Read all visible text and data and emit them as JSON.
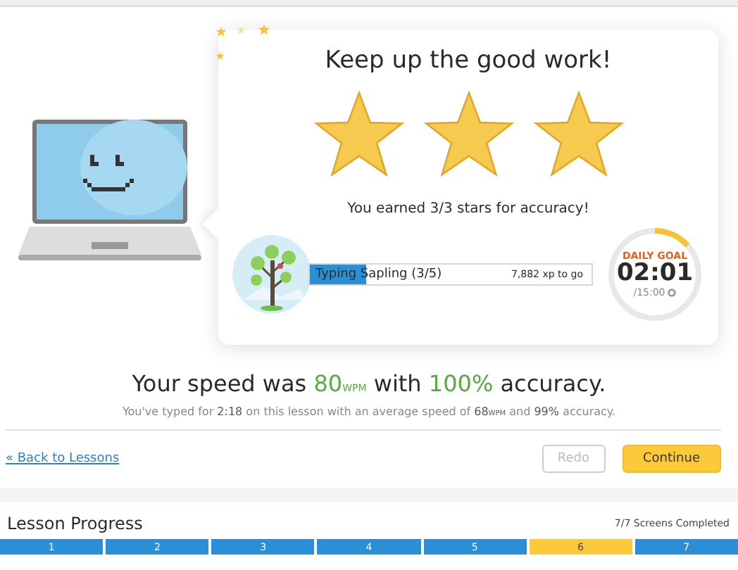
{
  "card": {
    "title": "Keep up the good work!",
    "stars": 3,
    "earned": "You earned 3/3 stars for accuracy!"
  },
  "level_bar": {
    "label": "Typing Sapling (3/5)",
    "level": 0.2,
    "xp": "7,882 xp to go"
  },
  "daily_goal": {
    "label": "DAILY GOAL",
    "time": "02:01",
    "total": "/15:00",
    "level": 0.134
  },
  "speed": [
    {
      "kind": "plain",
      "text": "Your speed was "
    },
    {
      "kind": "highlight",
      "text": "80"
    },
    {
      "kind": "unit",
      "text": "WPM"
    },
    {
      "kind": "plain",
      "text": " with "
    },
    {
      "kind": "highlight",
      "text": "100%"
    },
    {
      "kind": "plain",
      "text": " accuracy."
    }
  ],
  "summary": [
    {
      "kind": "plain",
      "text": "You've typed for "
    },
    {
      "kind": "highlight",
      "text": "2:18"
    },
    {
      "kind": "plain",
      "text": " on this lesson with an average speed of "
    },
    {
      "kind": "highlight",
      "text": "68"
    },
    {
      "kind": "unit",
      "text": "WPM"
    },
    {
      "kind": "plain",
      "text": " and "
    },
    {
      "kind": "highlight",
      "text": "99%"
    },
    {
      "kind": "plain",
      "text": " accuracy."
    }
  ],
  "back_link": "« Back to Lessons",
  "buttons": [
    {
      "label": "Redo",
      "disabled": true
    },
    {
      "label": "Continue",
      "disabled": false
    }
  ],
  "lesson_progress": {
    "title": "Lesson Progress",
    "completed": "7/7 Screens Completed",
    "screens": [
      {
        "label": "1",
        "selected": false
      },
      {
        "label": "2",
        "selected": false
      },
      {
        "label": "3",
        "selected": false
      },
      {
        "label": "4",
        "selected": false
      },
      {
        "label": "5",
        "selected": false
      },
      {
        "label": "6",
        "selected": true
      },
      {
        "label": "7",
        "selected": false
      }
    ]
  }
}
